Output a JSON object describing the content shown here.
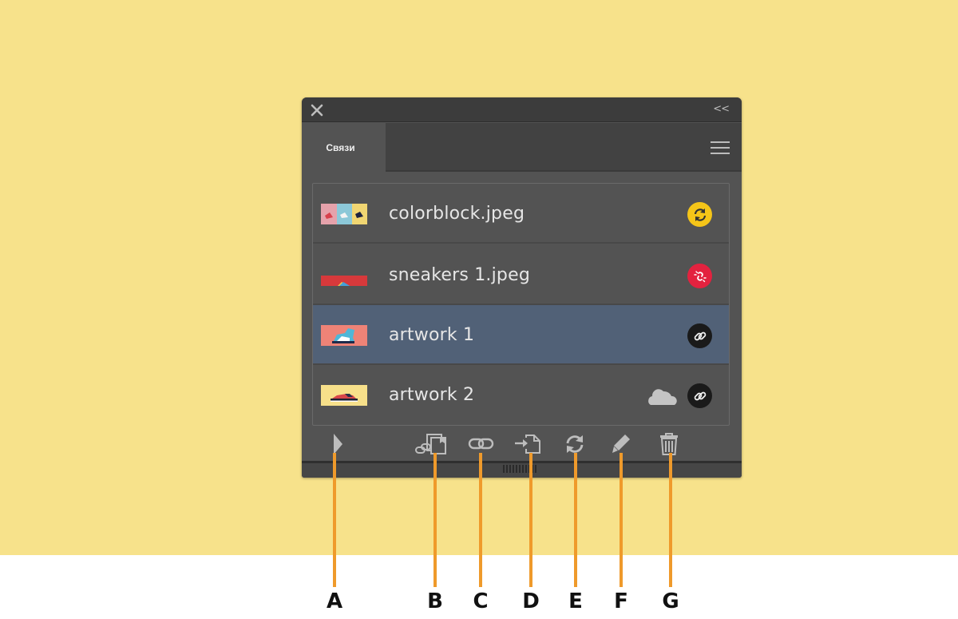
{
  "panel": {
    "close_icon": "close-icon",
    "collapse_label": "<<",
    "tab_label": "Связи",
    "menu_icon": "hamburger-menu-icon"
  },
  "links": [
    {
      "name": "colorblock.jpeg",
      "status": "modified",
      "status_icon": "sync-modified-icon",
      "status_color": "#f5c518",
      "selected": false,
      "cloud": false,
      "thumb_colors": [
        "#e9a0a8",
        "#8fc9d8",
        "#f2d86e"
      ]
    },
    {
      "name": "sneakers 1.jpeg",
      "status": "missing",
      "status_icon": "broken-link-icon",
      "status_color": "#e3223f",
      "selected": false,
      "cloud": false,
      "thumb_colors": [
        "#d8383a"
      ]
    },
    {
      "name": "artwork 1",
      "status": "linked",
      "status_icon": "link-icon",
      "status_color": "#1a1a1a",
      "selected": true,
      "cloud": false,
      "thumb_colors": [
        "#ef8478"
      ]
    },
    {
      "name": "artwork 2",
      "status": "linked",
      "status_icon": "link-icon",
      "status_color": "#1a1a1a",
      "selected": false,
      "cloud": true,
      "thumb_colors": [
        "#f7e08a"
      ]
    }
  ],
  "footer": {
    "buttons": [
      {
        "id": "A",
        "icon": "expand-triangle-icon",
        "action": "Show link info"
      },
      {
        "id": "B",
        "icon": "relink-from-library-icon",
        "action": "Relink from CC Libraries"
      },
      {
        "id": "C",
        "icon": "relink-icon",
        "action": "Relink"
      },
      {
        "id": "D",
        "icon": "go-to-link-icon",
        "action": "Go to link"
      },
      {
        "id": "E",
        "icon": "update-link-icon",
        "action": "Update link"
      },
      {
        "id": "F",
        "icon": "edit-original-icon",
        "action": "Edit original"
      },
      {
        "id": "G",
        "icon": "trash-icon",
        "action": "Delete"
      }
    ]
  },
  "callouts": [
    "A",
    "B",
    "C",
    "D",
    "E",
    "F",
    "G"
  ],
  "colors": {
    "background": "#f7e28b",
    "panel": "#535353",
    "selected_row": "#516177",
    "callout_line": "#ef9a2b"
  }
}
